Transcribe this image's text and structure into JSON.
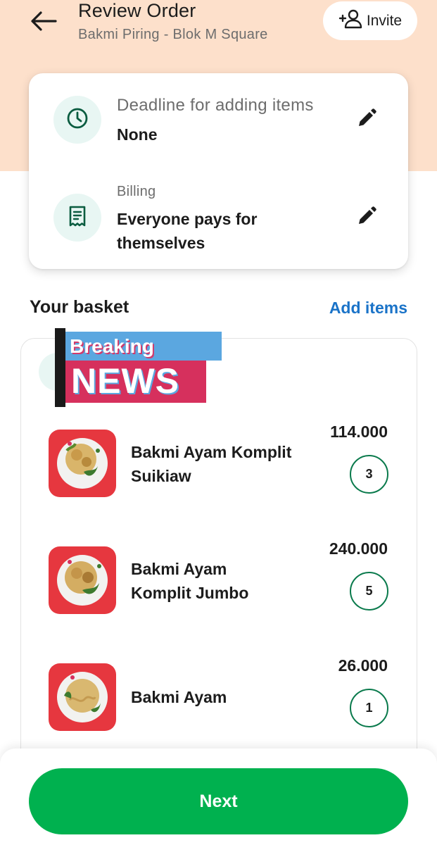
{
  "header": {
    "title": "Review Order",
    "subtitle": "Bakmi Piring - Blok M Square",
    "invite_label": "Invite",
    "back_icon": "arrow-left-icon",
    "invite_icon": "add-person-icon"
  },
  "details": {
    "deadline": {
      "label": "Deadline for adding items",
      "value": "None",
      "icon": "clock-icon"
    },
    "billing": {
      "label": "Billing",
      "value_line1": "Everyone pays for",
      "value_line2": "themselves",
      "icon": "receipt-icon"
    }
  },
  "basket": {
    "title": "Your basket",
    "add_items_label": "Add items",
    "items": [
      {
        "name_line1": "Bakmi Ayam Komplit",
        "name_line2": "Suikiaw",
        "price": "114.000",
        "qty": "3"
      },
      {
        "name_line1": "Bakmi Ayam",
        "name_line2": "Komplit Jumbo",
        "price": "240.000",
        "qty": "5"
      },
      {
        "name_line1": "Bakmi Ayam",
        "name_line2": "",
        "price": "26.000",
        "qty": "1"
      }
    ]
  },
  "overlay": {
    "top": "Breaking",
    "bottom": "NEWS"
  },
  "footer": {
    "next_label": "Next"
  },
  "colors": {
    "header_bg": "#fde0cb",
    "primary_green": "#00b14f",
    "link_blue": "#1a73c8",
    "icon_green": "#0a5c40",
    "qty_border": "#0a7a4c"
  }
}
